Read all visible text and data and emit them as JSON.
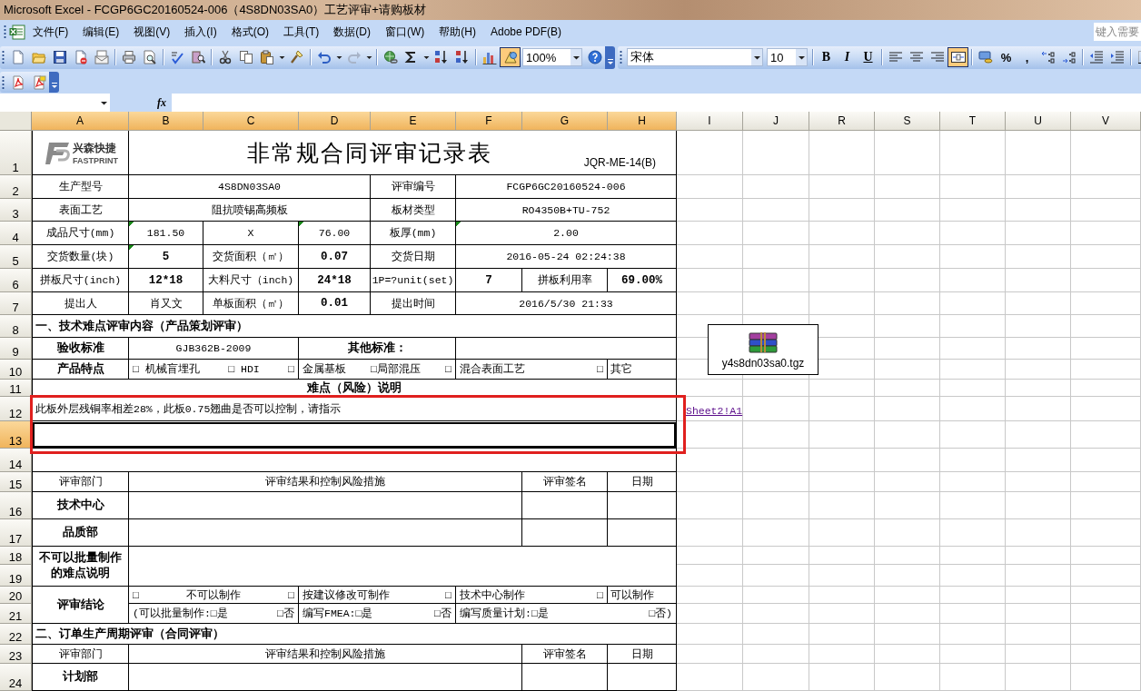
{
  "window": {
    "title": "Microsoft Excel - FCGP6GC20160524-006（4S8DN03SA0）工艺评审+请购板材"
  },
  "menu": {
    "items": [
      "文件(F)",
      "编辑(E)",
      "视图(V)",
      "插入(I)",
      "格式(O)",
      "工具(T)",
      "数据(D)",
      "窗口(W)",
      "帮助(H)",
      "Adobe PDF(B)"
    ],
    "help_field": {
      "placeholder": "键入需要"
    }
  },
  "standard_toolbar": [
    {
      "kind": "grip"
    },
    {
      "kind": "new",
      "pressed": false
    },
    {
      "kind": "open",
      "pressed": false
    },
    {
      "kind": "save",
      "pressed": false
    },
    {
      "kind": "permission",
      "pressed": false
    },
    {
      "kind": "mail",
      "pressed": false
    },
    {
      "kind": "separator"
    },
    {
      "kind": "print",
      "pressed": false
    },
    {
      "kind": "preview",
      "pressed": false
    },
    {
      "kind": "separator"
    },
    {
      "kind": "spelling",
      "pressed": false
    },
    {
      "kind": "research",
      "pressed": false
    },
    {
      "kind": "separator"
    },
    {
      "kind": "cut",
      "pressed": false
    },
    {
      "kind": "copy",
      "pressed": false
    },
    {
      "kind": "paste",
      "pressed": false
    },
    {
      "kind": "dropdown"
    },
    {
      "kind": "painter",
      "pressed": false
    },
    {
      "kind": "separator"
    },
    {
      "kind": "undo",
      "pressed": false
    },
    {
      "kind": "dropdown"
    },
    {
      "kind": "redo",
      "pressed": false
    },
    {
      "kind": "dropdown"
    },
    {
      "kind": "separator"
    },
    {
      "kind": "hyperlink",
      "pressed": false
    },
    {
      "kind": "autosum",
      "pressed": false
    },
    {
      "kind": "dropdown"
    },
    {
      "kind": "sort-asc",
      "pressed": false
    },
    {
      "kind": "sort-desc",
      "pressed": false
    },
    {
      "kind": "separator"
    },
    {
      "kind": "chart",
      "pressed": false
    },
    {
      "kind": "drawing",
      "pressed": true
    },
    {
      "kind": "zoom",
      "value": "100%"
    },
    {
      "kind": "help",
      "pressed": false
    },
    {
      "kind": "options"
    }
  ],
  "formatting_toolbar": [
    {
      "kind": "grip"
    },
    {
      "kind": "font",
      "value": "宋体"
    },
    {
      "kind": "size",
      "value": "10"
    },
    {
      "kind": "separator"
    },
    {
      "kind": "bold",
      "label": "B",
      "pressed": false
    },
    {
      "kind": "italic",
      "label": "I",
      "pressed": false
    },
    {
      "kind": "underline",
      "label": "U",
      "pressed": false
    },
    {
      "kind": "separator"
    },
    {
      "kind": "align-left",
      "pressed": false
    },
    {
      "kind": "align-center",
      "pressed": false
    },
    {
      "kind": "align-right",
      "pressed": false
    },
    {
      "kind": "merge",
      "pressed": true
    },
    {
      "kind": "separator"
    },
    {
      "kind": "currency",
      "pressed": false
    },
    {
      "kind": "percent",
      "label": "%",
      "pressed": false
    },
    {
      "kind": "comma",
      "label": ",",
      "pressed": false
    },
    {
      "kind": "inc-decimal",
      "pressed": false
    },
    {
      "kind": "dec-decimal",
      "pressed": false
    },
    {
      "kind": "separator"
    },
    {
      "kind": "outdent",
      "pressed": false
    },
    {
      "kind": "indent",
      "pressed": false
    },
    {
      "kind": "separator"
    },
    {
      "kind": "borders",
      "pressed": false
    }
  ],
  "pdf_toolbar": [
    {
      "kind": "grip"
    },
    {
      "kind": "pdf",
      "pressed": false
    },
    {
      "kind": "pdf-review",
      "pressed": false
    },
    {
      "kind": "options"
    }
  ],
  "formula_bar": {
    "function_label": "fx"
  },
  "sheet": {
    "columns": [
      {
        "label": "A",
        "selected": true
      },
      {
        "label": "B",
        "selected": true
      },
      {
        "label": "C",
        "selected": true
      },
      {
        "label": "D",
        "selected": true
      },
      {
        "label": "E",
        "selected": true
      },
      {
        "label": "F",
        "selected": true
      },
      {
        "label": "G",
        "selected": true
      },
      {
        "label": "H",
        "selected": true
      },
      {
        "label": "I",
        "selected": false
      },
      {
        "label": "J",
        "selected": false
      },
      {
        "label": "R",
        "selected": false
      },
      {
        "label": "S",
        "selected": false
      },
      {
        "label": "T",
        "selected": false
      },
      {
        "label": "U",
        "selected": false
      },
      {
        "label": "V",
        "selected": false
      }
    ],
    "rows": [
      {
        "number": "1",
        "selected": false,
        "cells": [
          {
            "kind": "logo",
            "lines": [
              "兴森快捷",
              "FASTPRINT"
            ],
            "selected": false,
            "flagged": false
          },
          {
            "kind": "title",
            "text": "非常规合同评审记录表",
            "code": "JQR-ME-14(B)",
            "selected": false,
            "flagged": false
          }
        ]
      },
      {
        "number": "2",
        "selected": false,
        "cells": [
          {
            "kind": "text",
            "text": "生产型号",
            "selected": false,
            "flagged": false
          },
          {
            "kind": "text",
            "text": "4S8DN03SA0",
            "selected": false,
            "flagged": false
          },
          {
            "kind": "text",
            "text": "评审编号",
            "selected": false,
            "flagged": false
          },
          {
            "kind": "text",
            "text": "FCGP6GC20160524-006",
            "selected": false,
            "flagged": false
          }
        ]
      },
      {
        "number": "3",
        "selected": false,
        "cells": [
          {
            "kind": "text",
            "text": "表面工艺",
            "selected": false,
            "flagged": false
          },
          {
            "kind": "text",
            "text": "阻抗喷锡高频板",
            "selected": false,
            "flagged": false
          },
          {
            "kind": "text",
            "text": "板材类型",
            "selected": false,
            "flagged": false
          },
          {
            "kind": "text",
            "text": "RO4350B+TU-752",
            "selected": false,
            "flagged": false
          }
        ]
      },
      {
        "number": "4",
        "selected": false,
        "cells": [
          {
            "kind": "text",
            "text": "成品尺寸(mm)",
            "selected": false,
            "flagged": false
          },
          {
            "kind": "text",
            "text": "181.50",
            "selected": false,
            "flagged": true
          },
          {
            "kind": "text",
            "text": "X",
            "selected": false,
            "flagged": false
          },
          {
            "kind": "text",
            "text": "76.00",
            "selected": false,
            "flagged": true
          },
          {
            "kind": "text",
            "text": "板厚(mm)",
            "selected": false,
            "flagged": false
          },
          {
            "kind": "text",
            "text": "2.00",
            "selected": false,
            "flagged": true
          }
        ]
      },
      {
        "number": "5",
        "selected": false,
        "cells": [
          {
            "kind": "text",
            "text": "交货数量(块)",
            "selected": false,
            "flagged": false
          },
          {
            "kind": "text",
            "text": "5",
            "selected": false,
            "flagged": true
          },
          {
            "kind": "text",
            "text": "交货面积（㎡）",
            "selected": false,
            "flagged": false
          },
          {
            "kind": "text",
            "text": "0.07",
            "selected": false,
            "flagged": false
          },
          {
            "kind": "text",
            "text": "交货日期",
            "selected": false,
            "flagged": false
          },
          {
            "kind": "text",
            "text": "2016-05-24 02:24:38",
            "selected": false,
            "flagged": false
          }
        ]
      },
      {
        "number": "6",
        "selected": false,
        "cells": [
          {
            "kind": "text",
            "text": "拼板尺寸(inch)",
            "selected": false,
            "flagged": false
          },
          {
            "kind": "text",
            "text": "12*18",
            "selected": false,
            "flagged": false
          },
          {
            "kind": "text",
            "text": "大料尺寸（inch)",
            "selected": false,
            "flagged": false
          },
          {
            "kind": "text",
            "text": "24*18",
            "selected": false,
            "flagged": false
          },
          {
            "kind": "text",
            "text": "1P=?unit(set)",
            "selected": false,
            "flagged": false
          },
          {
            "kind": "text",
            "text": "7",
            "selected": false,
            "flagged": false
          },
          {
            "kind": "text",
            "text": "拼板利用率",
            "selected": false,
            "flagged": false
          },
          {
            "kind": "text",
            "text": "69.00%",
            "selected": false,
            "flagged": false
          }
        ]
      },
      {
        "number": "7",
        "selected": false,
        "cells": [
          {
            "kind": "text",
            "text": "提出人",
            "selected": false,
            "flagged": false
          },
          {
            "kind": "text",
            "text": "肖又文",
            "selected": false,
            "flagged": false
          },
          {
            "kind": "text",
            "text": "单板面积（㎡）",
            "selected": false,
            "flagged": false
          },
          {
            "kind": "text",
            "text": "0.01",
            "selected": false,
            "flagged": false
          },
          {
            "kind": "text",
            "text": "提出时间",
            "selected": false,
            "flagged": false
          },
          {
            "kind": "text",
            "text": "2016/5/30 21:33",
            "selected": false,
            "flagged": false
          }
        ]
      },
      {
        "number": "8",
        "selected": false,
        "cells": [
          {
            "kind": "text",
            "text": "一、技术难点评审内容（产品策划评审）",
            "selected": false,
            "flagged": false
          }
        ]
      },
      {
        "number": "9",
        "selected": false,
        "cells": [
          {
            "kind": "text",
            "text": "验收标准",
            "selected": false,
            "flagged": false
          },
          {
            "kind": "text",
            "text": "GJB362B-2009",
            "selected": false,
            "flagged": false
          },
          {
            "kind": "text",
            "text": "其他标准：",
            "selected": false,
            "flagged": false
          }
        ]
      },
      {
        "number": "10",
        "selected": false,
        "cells": [
          {
            "kind": "text",
            "text": "产品特点",
            "selected": false,
            "flagged": false
          },
          {
            "kind": "parts",
            "parts": [
              "□ 机械盲埋孔",
              "□ HDI",
              "□"
            ],
            "selected": false,
            "flagged": false
          },
          {
            "kind": "parts",
            "parts": [
              "金属基板",
              "□局部混压",
              "□"
            ],
            "selected": false,
            "flagged": false
          },
          {
            "kind": "parts",
            "parts": [
              "混合表面工艺",
              "□"
            ],
            "selected": false,
            "flagged": false
          },
          {
            "kind": "text",
            "text": "其它",
            "selected": false,
            "flagged": false
          }
        ]
      },
      {
        "number": "11",
        "selected": false,
        "cells": [
          {
            "kind": "text",
            "text": "难点（风险）说明",
            "selected": false,
            "flagged": false
          }
        ]
      },
      {
        "number": "12",
        "selected": false,
        "cells": [
          {
            "kind": "text",
            "text": "此板外层残铜率相差28%，此板0.75翘曲是否可以控制，请指示",
            "selected": false,
            "flagged": false
          },
          {
            "kind": "link",
            "text": "Sheet2!A1"
          }
        ]
      },
      {
        "number": "13",
        "selected": true,
        "cells": [
          {
            "kind": "blank",
            "selected": true,
            "flagged": false
          }
        ]
      },
      {
        "number": "14",
        "selected": false
      },
      {
        "number": "15",
        "selected": false,
        "cells": [
          {
            "kind": "text",
            "text": "评审部门",
            "selected": false,
            "flagged": false
          },
          {
            "kind": "text",
            "text": "评审结果和控制风险措施",
            "selected": false,
            "flagged": false
          },
          {
            "kind": "text",
            "text": "评审签名",
            "selected": false,
            "flagged": false
          },
          {
            "kind": "text",
            "text": "日期",
            "selected": false,
            "flagged": false
          }
        ]
      },
      {
        "number": "16",
        "selected": false,
        "cells": [
          {
            "kind": "text",
            "text": "技术中心",
            "selected": false,
            "flagged": false
          }
        ]
      },
      {
        "number": "17",
        "selected": false,
        "cells": [
          {
            "kind": "text",
            "text": "品质部",
            "selected": false,
            "flagged": false
          }
        ]
      },
      {
        "number": "18",
        "selected": false,
        "cells": [
          {
            "kind": "text",
            "text": "不可以批量制作的难点说明",
            "selected": false,
            "flagged": false
          }
        ]
      },
      {
        "number": "19",
        "selected": false
      },
      {
        "number": "20",
        "selected": false,
        "cells": [
          {
            "kind": "text",
            "text": "评审结论",
            "selected": false,
            "flagged": false
          },
          {
            "kind": "parts",
            "parts": [
              "□",
              "不可以制作",
              "□"
            ],
            "selected": false,
            "flagged": false
          },
          {
            "kind": "parts",
            "parts": [
              "按建议修改可制作",
              "□"
            ],
            "selected": false,
            "flagged": false
          },
          {
            "kind": "parts",
            "parts": [
              "技术中心制作",
              "□"
            ],
            "selected": false,
            "flagged": false
          },
          {
            "kind": "text",
            "text": "可以制作",
            "selected": false,
            "flagged": false
          }
        ]
      },
      {
        "number": "21",
        "selected": false,
        "cells": [
          {
            "kind": "parts",
            "parts": [
              "(可以批量制作:□是",
              "□否"
            ],
            "selected": false,
            "flagged": false
          },
          {
            "kind": "parts",
            "parts": [
              "编写FMEA:□是",
              "□否"
            ],
            "selected": false,
            "flagged": false
          },
          {
            "kind": "parts",
            "parts": [
              "编写质量计划:□是",
              "□否)"
            ],
            "selected": false,
            "flagged": false
          }
        ]
      },
      {
        "number": "22",
        "selected": false,
        "cells": [
          {
            "kind": "text",
            "text": "二、订单生产周期评审（合同评审）",
            "selected": false,
            "flagged": false
          }
        ]
      },
      {
        "number": "23",
        "selected": false,
        "cells": [
          {
            "kind": "text",
            "text": "评审部门",
            "selected": false,
            "flagged": false
          },
          {
            "kind": "text",
            "text": "评审结果和控制风险措施",
            "selected": false,
            "flagged": false
          },
          {
            "kind": "text",
            "text": "评审签名",
            "selected": false,
            "flagged": false
          },
          {
            "kind": "text",
            "text": "日期",
            "selected": false,
            "flagged": false
          }
        ]
      },
      {
        "number": "24",
        "selected": false,
        "cells": [
          {
            "kind": "text",
            "text": "计划部",
            "selected": false,
            "flagged": false
          }
        ]
      }
    ],
    "embedded_object": {
      "label": "y4s8dn03sa0.tgz"
    }
  }
}
